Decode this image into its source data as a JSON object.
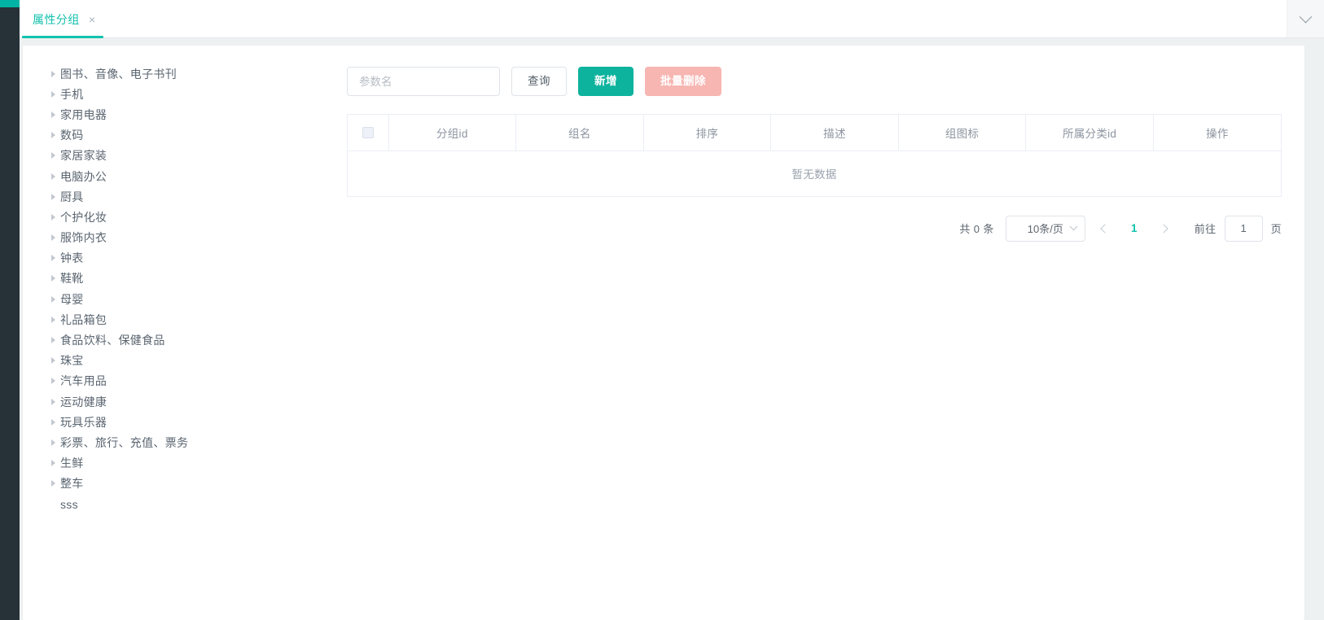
{
  "rail": {
    "accent_color": "#00b3a4",
    "bg_color": "#263238"
  },
  "tabbar": {
    "tab_label": "属性分组",
    "tab_close_icon": "×",
    "collapse_icon": "chevron-down-icon",
    "accent_color": "#13c2ad"
  },
  "tree": {
    "items": [
      {
        "label": "图书、音像、电子书刊",
        "expandable": true
      },
      {
        "label": "手机",
        "expandable": true
      },
      {
        "label": "家用电器",
        "expandable": true
      },
      {
        "label": "数码",
        "expandable": true
      },
      {
        "label": "家居家装",
        "expandable": true
      },
      {
        "label": "电脑办公",
        "expandable": true
      },
      {
        "label": "厨具",
        "expandable": true
      },
      {
        "label": "个护化妆",
        "expandable": true
      },
      {
        "label": "服饰内衣",
        "expandable": true
      },
      {
        "label": "钟表",
        "expandable": true
      },
      {
        "label": "鞋靴",
        "expandable": true
      },
      {
        "label": "母婴",
        "expandable": true
      },
      {
        "label": "礼品箱包",
        "expandable": true
      },
      {
        "label": "食品饮料、保健食品",
        "expandable": true
      },
      {
        "label": "珠宝",
        "expandable": true
      },
      {
        "label": "汽车用品",
        "expandable": true
      },
      {
        "label": "运动健康",
        "expandable": true
      },
      {
        "label": "玩具乐器",
        "expandable": true
      },
      {
        "label": "彩票、旅行、充值、票务",
        "expandable": true
      },
      {
        "label": "生鲜",
        "expandable": true
      },
      {
        "label": "整车",
        "expandable": true
      },
      {
        "label": "sss",
        "expandable": false
      }
    ]
  },
  "toolbar": {
    "search_placeholder": "参数名",
    "search_value": "",
    "query_label": "查询",
    "add_label": "新增",
    "batch_delete_label": "批量删除",
    "primary_color": "#0eb39e",
    "danger_color": "#f7b6b2"
  },
  "table": {
    "columns": [
      "分组id",
      "组名",
      "排序",
      "描述",
      "组图标",
      "所属分类id",
      "操作"
    ],
    "rows": [],
    "empty_text": "暂无数据"
  },
  "pagination": {
    "total_text": "共 0 条",
    "page_size_label": "10条/页",
    "current_page": "1",
    "jump_label": "前往",
    "jump_value": "1",
    "jump_suffix": "页",
    "active_color": "#13c2ad"
  }
}
